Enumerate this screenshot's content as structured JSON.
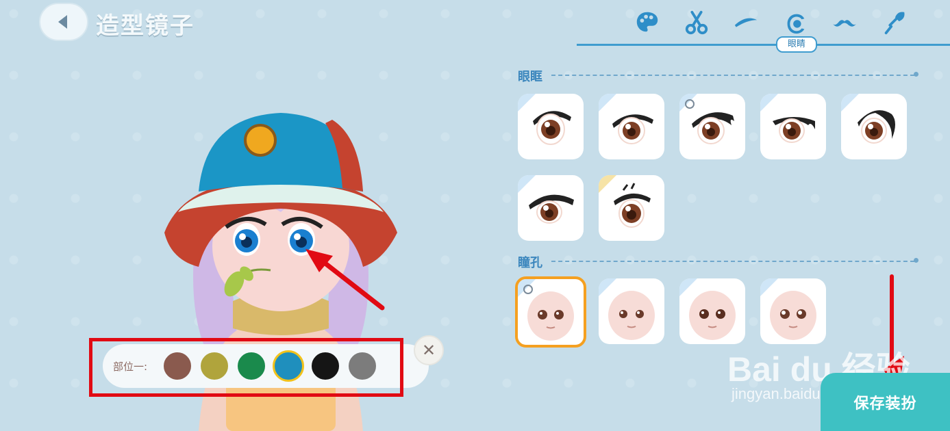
{
  "header": {
    "title": "造型镜子"
  },
  "tabs": {
    "items": [
      {
        "name": "palette-icon"
      },
      {
        "name": "scissors-icon"
      },
      {
        "name": "eyebrow-icon"
      },
      {
        "name": "eye-icon"
      },
      {
        "name": "mustache-icon"
      },
      {
        "name": "brush-icon"
      }
    ],
    "active_label": "眼睛"
  },
  "sections": {
    "eye_frame": {
      "title": "眼眶"
    },
    "pupil": {
      "title": "瞳孔"
    }
  },
  "palette": {
    "label": "部位一:",
    "colors": [
      "#8a5a4e",
      "#b0a43c",
      "#1a8a4c",
      "#1f8fbd",
      "#151515",
      "#7c7c7c"
    ],
    "active_index": 3
  },
  "close_symbol": "✕",
  "save": {
    "label": "保存装扮"
  },
  "watermark": {
    "brand": "Bai du 经验",
    "url": "jingyan.baidu.com"
  },
  "colors": {
    "accent": "#3f9ccf",
    "selected": "#f5a020",
    "save_button": "#3ec1c3",
    "annotation": "#e10a13"
  }
}
